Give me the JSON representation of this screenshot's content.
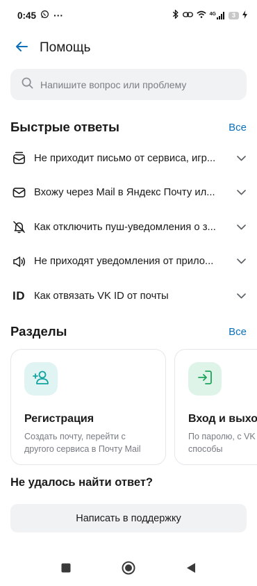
{
  "status_bar": {
    "time": "0:45",
    "dots": "···",
    "network": "4G",
    "battery": "3"
  },
  "header": {
    "title": "Помощь"
  },
  "search": {
    "placeholder": "Напишите вопрос или проблему"
  },
  "quick_answers": {
    "title": "Быстрые ответы",
    "all_link": "Все",
    "items": [
      {
        "icon": "mail-badge-icon",
        "label": "Не приходит письмо от сервиса, игр..."
      },
      {
        "icon": "envelope-icon",
        "label": "Вхожу через Mail в Яндекс Почту ил..."
      },
      {
        "icon": "bell-off-icon",
        "label": "Как отключить пуш-уведомления о з..."
      },
      {
        "icon": "speaker-icon",
        "label": "Не приходят уведомления от прило..."
      },
      {
        "icon": "id-icon",
        "icon_text": "ID",
        "label": "Как отвязать VK ID от почты"
      }
    ]
  },
  "sections": {
    "title": "Разделы",
    "all_link": "Все",
    "cards": [
      {
        "icon": "add-user-icon",
        "title": "Регистрация",
        "description": "Создать почту, перейти с другого сервиса в Почту Mail",
        "icon_bg": "#dff4f3",
        "icon_color": "#12a3a0"
      },
      {
        "icon": "login-icon",
        "title": "Вход и выход",
        "description": "По паролю, с VK ID, другие способы",
        "icon_bg": "#dff4e8",
        "icon_color": "#1ea35a"
      }
    ]
  },
  "support": {
    "question": "Не удалось найти ответ?",
    "button_label": "Написать в поддержку"
  },
  "colors": {
    "accent": "#0a6fb9",
    "surface": "#f1f2f4"
  }
}
